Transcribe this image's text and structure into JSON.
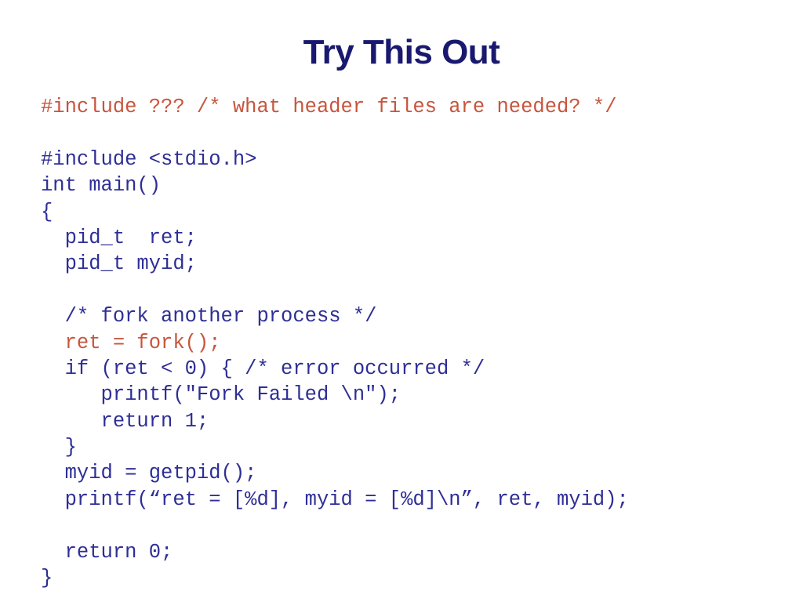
{
  "slide": {
    "title": "Try This Out",
    "title_color": "#191970",
    "background_color": "#ffffff",
    "code_colors": {
      "navy": "#2e2e96",
      "rust": "#c8553d"
    },
    "code_lines": [
      {
        "text": "#include ??? /* what header files are needed? */",
        "color": "rust"
      },
      {
        "text": "",
        "color": "navy"
      },
      {
        "text": "#include <stdio.h>",
        "color": "navy"
      },
      {
        "text": "int main()",
        "color": "navy"
      },
      {
        "text": "{",
        "color": "navy"
      },
      {
        "text": "  pid_t  ret;",
        "color": "navy"
      },
      {
        "text": "  pid_t myid;",
        "color": "navy"
      },
      {
        "text": "",
        "color": "navy"
      },
      {
        "text": "  /* fork another process */",
        "color": "navy"
      },
      {
        "text": "  ret = fork();",
        "color": "rust"
      },
      {
        "text": "  if (ret < 0) { /* error occurred */",
        "color": "navy"
      },
      {
        "text": "     printf(\"Fork Failed \\n\");",
        "color": "navy"
      },
      {
        "text": "     return 1;",
        "color": "navy"
      },
      {
        "text": "  }",
        "color": "navy"
      },
      {
        "text": "  myid = getpid();",
        "color": "navy"
      },
      {
        "text": "  printf(“ret = [%d], myid = [%d]\\n”, ret, myid);",
        "color": "navy"
      },
      {
        "text": "",
        "color": "navy"
      },
      {
        "text": "  return 0;",
        "color": "navy"
      },
      {
        "text": "}",
        "color": "navy"
      }
    ]
  }
}
